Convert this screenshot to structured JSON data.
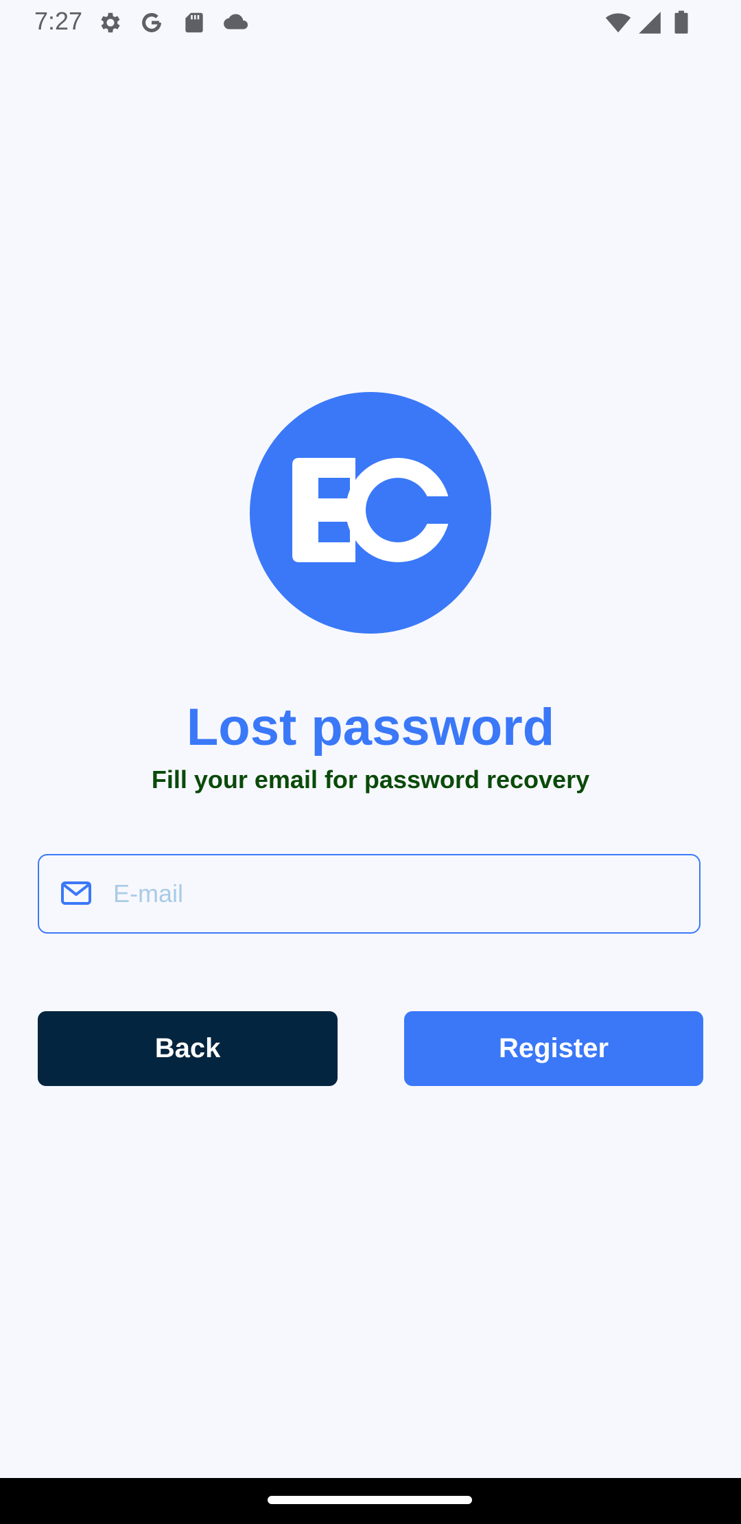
{
  "status_bar": {
    "time": "7:27",
    "left_icons": [
      "gear-icon",
      "google-icon",
      "sd-card-icon",
      "cloud-icon"
    ],
    "right_icons": [
      "wifi-icon",
      "cell-signal-icon",
      "battery-icon"
    ]
  },
  "logo": {
    "text": "EC",
    "color": "#3a78f8"
  },
  "header": {
    "title": "Lost password",
    "subtitle": "Fill your email for password recovery"
  },
  "form": {
    "email_placeholder": "E-mail",
    "email_value": "",
    "email_icon": "envelope-icon"
  },
  "buttons": {
    "back_label": "Back",
    "register_label": "Register"
  },
  "colors": {
    "primary": "#3a78f8",
    "dark": "#03253f",
    "subtitle": "#0a4a0a",
    "background": "#f7f8fd",
    "placeholder": "#a9cbe6"
  }
}
